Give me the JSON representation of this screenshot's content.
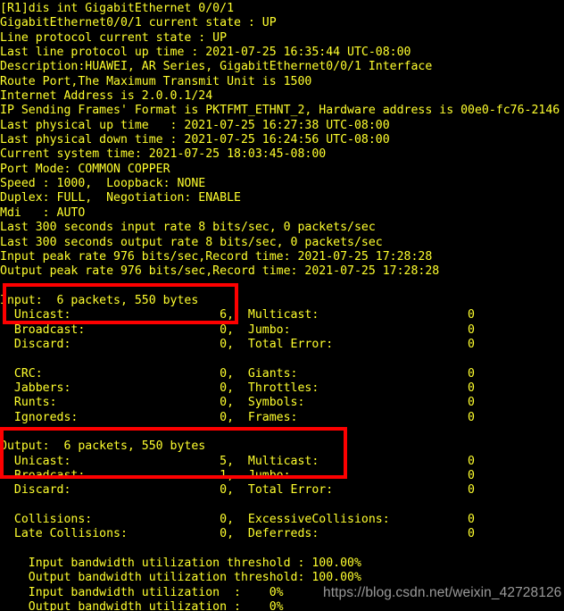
{
  "terminal": {
    "prompt": "[R1]",
    "command": "dis int GigabitEthernet 0/0/1",
    "colors": {
      "background": "#000000",
      "text": "#ffff2e",
      "highlight_box": "#fe0000",
      "watermark": "#9a9a9a"
    },
    "lines": [
      "[R1]dis int GigabitEthernet 0/0/1",
      "GigabitEthernet0/0/1 current state : UP",
      "Line protocol current state : UP",
      "Last line protocol up time : 2021-07-25 16:35:44 UTC-08:00",
      "Description:HUAWEI, AR Series, GigabitEthernet0/0/1 Interface",
      "Route Port,The Maximum Transmit Unit is 1500",
      "Internet Address is 2.0.0.1/24",
      "IP Sending Frames' Format is PKTFMT_ETHNT_2, Hardware address is 00e0-fc76-2146",
      "Last physical up time   : 2021-07-25 16:27:38 UTC-08:00",
      "Last physical down time : 2021-07-25 16:24:56 UTC-08:00",
      "Current system time: 2021-07-25 18:03:45-08:00",
      "Port Mode: COMMON COPPER",
      "Speed : 1000,  Loopback: NONE",
      "Duplex: FULL,  Negotiation: ENABLE",
      "Mdi   : AUTO",
      "Last 300 seconds input rate 8 bits/sec, 0 packets/sec",
      "Last 300 seconds output rate 8 bits/sec, 0 packets/sec",
      "Input peak rate 976 bits/sec,Record time: 2021-07-25 17:28:28",
      "Output peak rate 976 bits/sec,Record time: 2021-07-25 17:28:28",
      "",
      "Input:  6 packets, 550 bytes",
      "  Unicast:                     6,  Multicast:                     0",
      "  Broadcast:                   0,  Jumbo:                         0",
      "  Discard:                     0,  Total Error:                   0",
      "",
      "  CRC:                         0,  Giants:                        0",
      "  Jabbers:                     0,  Throttles:                     0",
      "  Runts:                       0,  Symbols:                       0",
      "  Ignoreds:                    0,  Frames:                        0",
      "",
      "Output:  6 packets, 550 bytes",
      "  Unicast:                     5,  Multicast:                     0",
      "  Broadcast:                   1,  Jumbo:                         0",
      "  Discard:                     0,  Total Error:                   0",
      "",
      "  Collisions:                  0,  ExcessiveCollisions:           0",
      "  Late Collisions:             0,  Deferreds:                     0",
      "",
      "    Input bandwidth utilization threshold : 100.00%",
      "    Output bandwidth utilization threshold: 100.00%",
      "    Input bandwidth utilization  :    0%",
      "    Output bandwidth utilization :    0%"
    ],
    "interface": {
      "name": "GigabitEthernet0/0/1",
      "current_state": "UP",
      "line_protocol_state": "UP",
      "last_line_protocol_up_time": "2021-07-25 16:35:44 UTC-08:00",
      "description": "HUAWEI, AR Series, GigabitEthernet0/0/1 Interface",
      "port_type": "Route Port",
      "mtu": "1500",
      "internet_address": "2.0.0.1/24",
      "frame_format": "PKTFMT_ETHNT_2",
      "hardware_address": "00e0-fc76-2146",
      "last_physical_up_time": "2021-07-25 16:27:38 UTC-08:00",
      "last_physical_down_time": "2021-07-25 16:24:56 UTC-08:00",
      "current_system_time": "2021-07-25 18:03:45-08:00",
      "port_mode": "COMMON COPPER",
      "speed": "1000",
      "loopback": "NONE",
      "duplex": "FULL",
      "negotiation": "ENABLE",
      "mdi": "AUTO",
      "last_300s_input_rate": "8 bits/sec, 0 packets/sec",
      "last_300s_output_rate": "8 bits/sec, 0 packets/sec",
      "input_peak_rate": "976 bits/sec",
      "input_peak_record_time": "2021-07-25 17:28:28",
      "output_peak_rate": "976 bits/sec",
      "output_peak_record_time": "2021-07-25 17:28:28"
    },
    "input_stats": {
      "summary": "6 packets, 550 bytes",
      "unicast": "6",
      "multicast": "0",
      "broadcast": "0",
      "jumbo": "0",
      "discard": "0",
      "total_error": "0",
      "crc": "0",
      "giants": "0",
      "jabbers": "0",
      "throttles": "0",
      "runts": "0",
      "symbols": "0",
      "ignoreds": "0",
      "frames": "0"
    },
    "output_stats": {
      "summary": "6 packets, 550 bytes",
      "unicast": "5",
      "multicast": "0",
      "broadcast": "1",
      "jumbo": "0",
      "discard": "0",
      "total_error": "0",
      "collisions": "0",
      "excessive_collisions": "0",
      "late_collisions": "0",
      "deferreds": "0"
    },
    "bandwidth": {
      "input_threshold": "100.00%",
      "output_threshold": "100.00%",
      "input_utilization": "0%",
      "output_utilization": "0%"
    }
  },
  "watermark": {
    "text": "https://blog.csdn.net/weixin_42728126"
  }
}
